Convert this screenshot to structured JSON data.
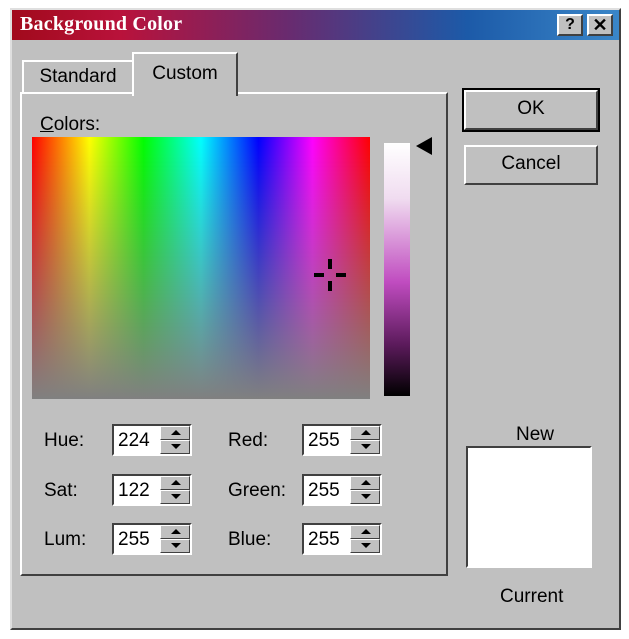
{
  "window": {
    "title": "Background Color",
    "help_glyph": "?",
    "close_glyph": "✕"
  },
  "tabs": [
    {
      "label": "Standard",
      "active": false
    },
    {
      "label": "Custom",
      "active": true
    }
  ],
  "custom": {
    "colors_label": "Colors:",
    "fields": {
      "hue": {
        "label": "Hue:",
        "value": "224"
      },
      "sat": {
        "label": "Sat:",
        "value": "122"
      },
      "lum": {
        "label": "Lum:",
        "value": "255"
      },
      "red": {
        "label": "Red:",
        "value": "255"
      },
      "green": {
        "label": "Green:",
        "value": "255"
      },
      "blue": {
        "label": "Blue:",
        "value": "255"
      }
    }
  },
  "buttons": {
    "ok": "OK",
    "cancel": "Cancel"
  },
  "preview": {
    "new_label": "New",
    "current_label": "Current",
    "new_color": "#ffffff",
    "current_color": "#ffffff"
  },
  "colors": {
    "face": "#c0c0c0",
    "title_start": "#a10a1c",
    "title_end": "#3a86c8"
  }
}
